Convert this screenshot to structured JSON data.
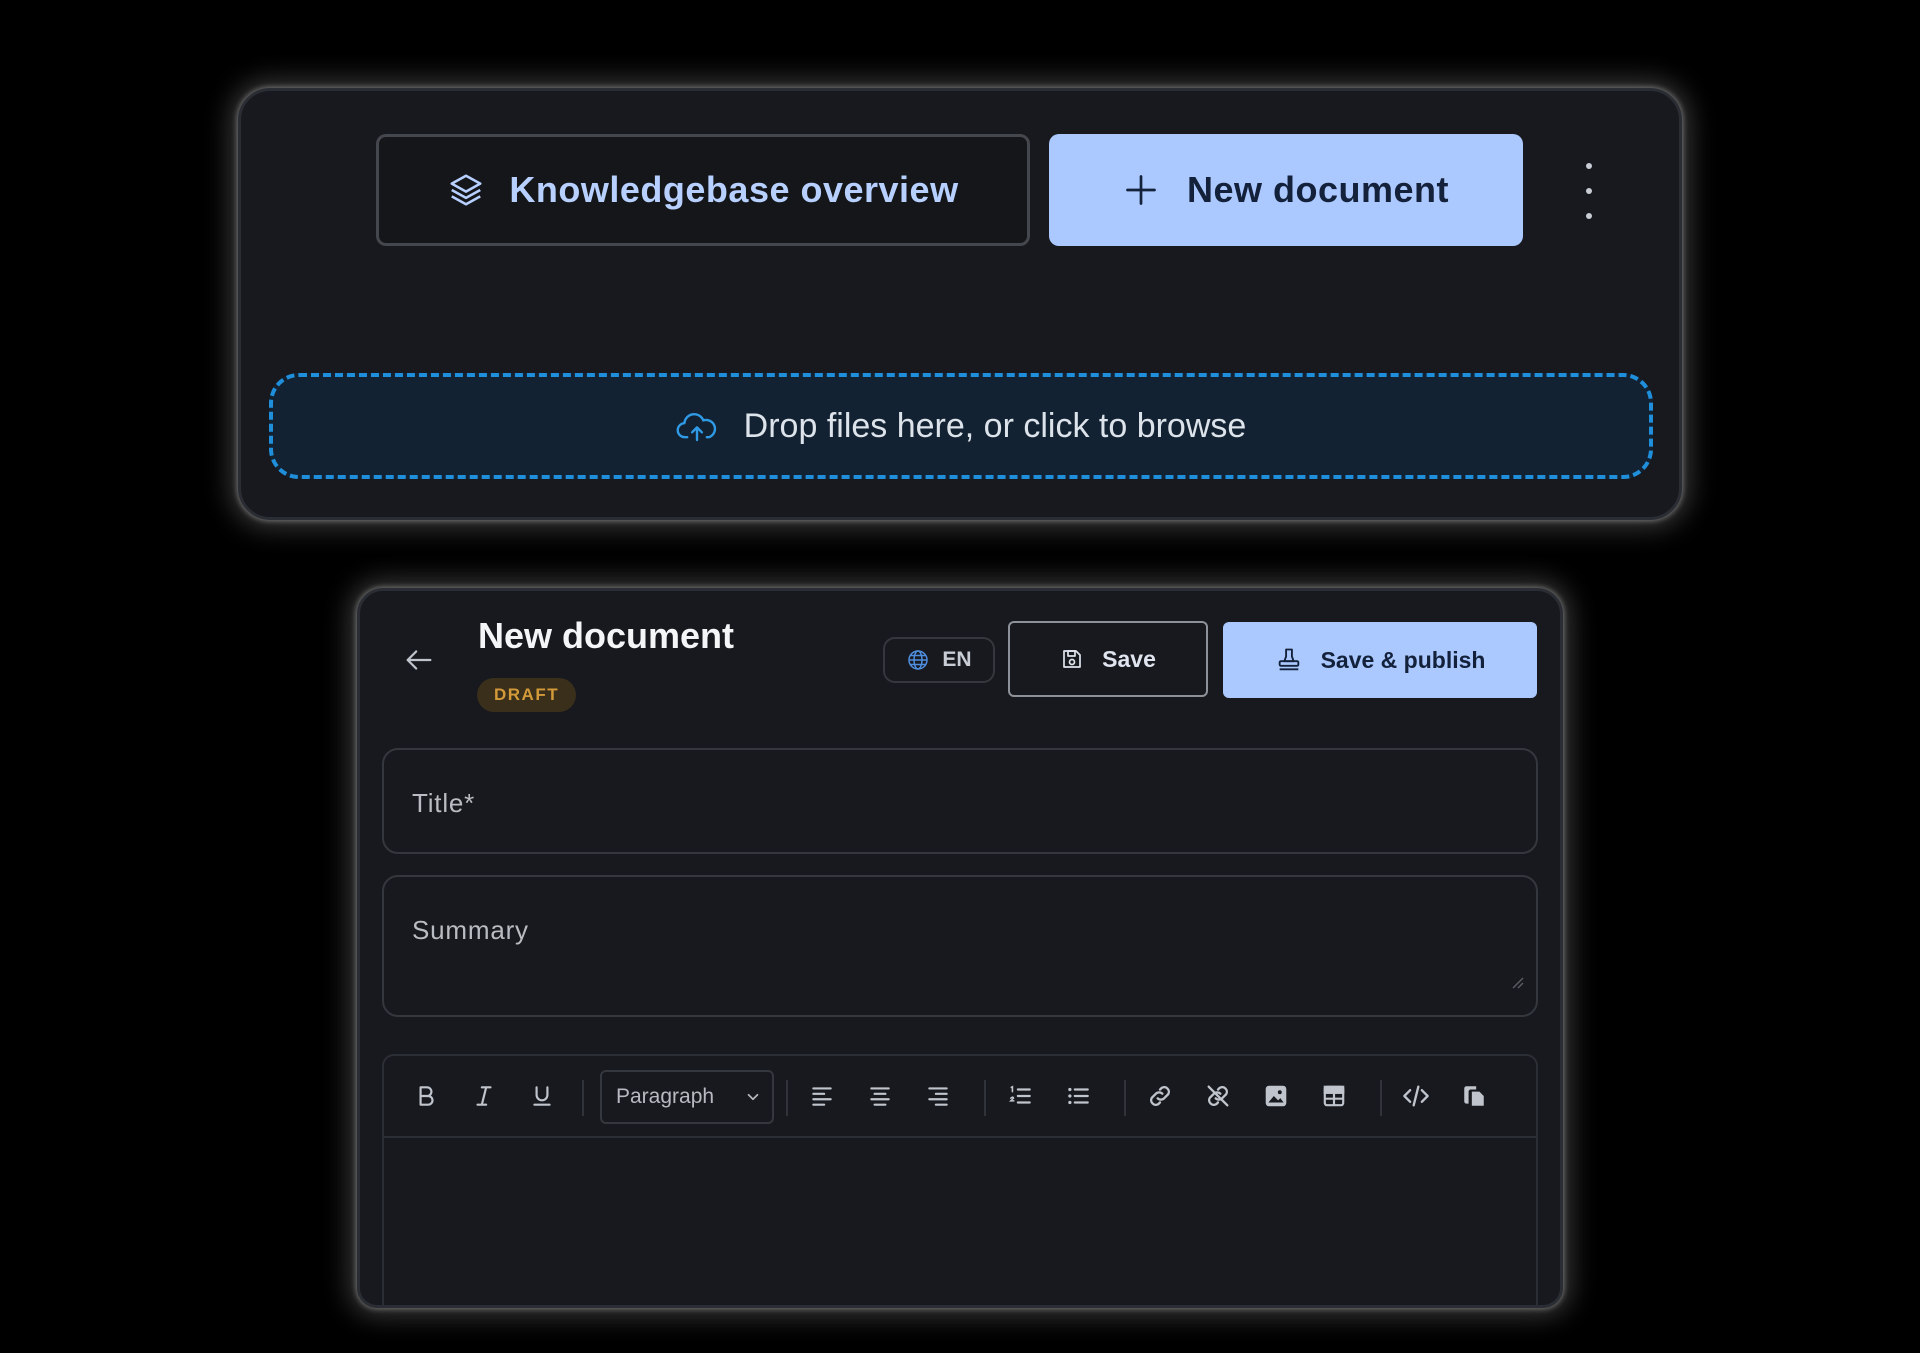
{
  "top_card": {
    "overview_button": "Knowledgebase overview",
    "new_document_button": "New document",
    "more_menu": "more-vertical-icon",
    "dropzone_text": "Drop files here, or click to browse"
  },
  "editor": {
    "title": "New document",
    "status_badge": "DRAFT",
    "language": "EN",
    "save_label": "Save",
    "publish_label": "Save & publish",
    "fields": {
      "title_placeholder": "Title*",
      "summary_placeholder": "Summary"
    },
    "toolbar": {
      "block_format": "Paragraph",
      "buttons": [
        "bold",
        "italic",
        "underline",
        "align-left",
        "align-center",
        "align-right",
        "ordered-list",
        "bullet-list",
        "link",
        "unlink",
        "image",
        "table",
        "code",
        "paste"
      ]
    }
  },
  "colors": {
    "background": "#000000",
    "card": "#17191e",
    "accent": "#abc8ff",
    "accent_text": "#b7d0ff",
    "dropzone_border": "#1f8fdc",
    "draft_text": "#d39a3a"
  }
}
